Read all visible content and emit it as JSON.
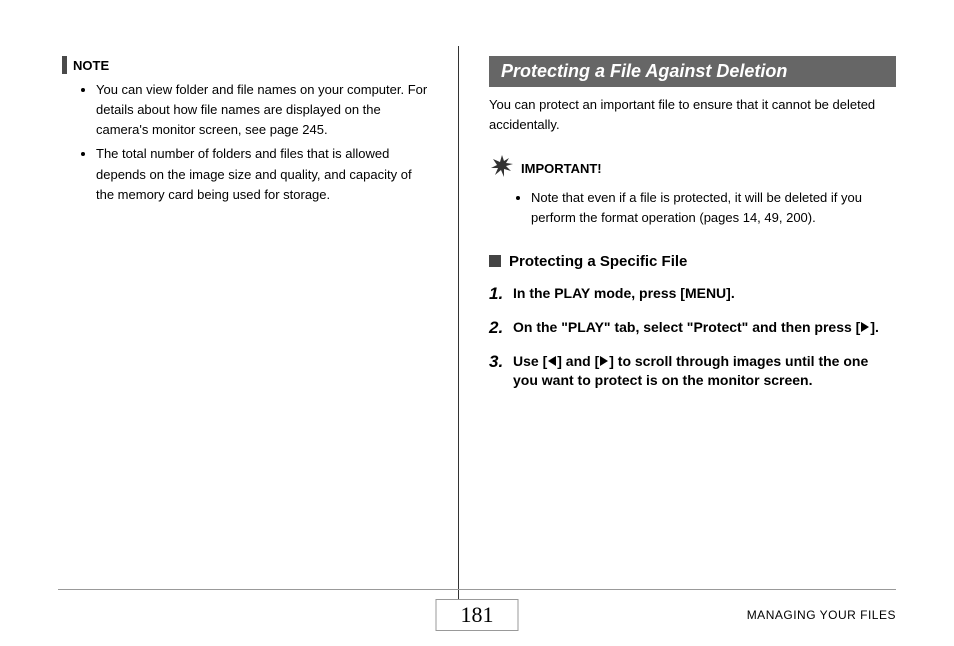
{
  "left": {
    "note_label": "NOTE",
    "bullets": [
      "You can view folder and file names on your computer. For details about how file names are displayed on the camera's monitor screen, see page 245.",
      "The total number of folders and files that is allowed depends on the image size and quality, and capacity of the memory card being used for storage."
    ]
  },
  "right": {
    "section_title": "Protecting a File Against Deletion",
    "intro": "You can protect an important file to ensure that it cannot be deleted accidentally.",
    "important_label": "IMPORTANT!",
    "important_items": [
      "Note that even if a file is protected, it will be deleted if you perform the format operation (pages 14, 49, 200)."
    ],
    "subhead": "Protecting a Specific File",
    "steps": {
      "s1_num": "1.",
      "s1_text": "In the PLAY mode, press [MENU].",
      "s2_num": "2.",
      "s2_a": "On the \"PLAY\" tab, select \"Protect\" and then press [",
      "s2_b": "].",
      "s3_num": "3.",
      "s3_a": "Use [",
      "s3_b": "] and [",
      "s3_c": "] to scroll through images until the one you want to protect is on the monitor screen."
    }
  },
  "footer": {
    "page_number": "181",
    "section_name": "MANAGING YOUR FILES"
  }
}
